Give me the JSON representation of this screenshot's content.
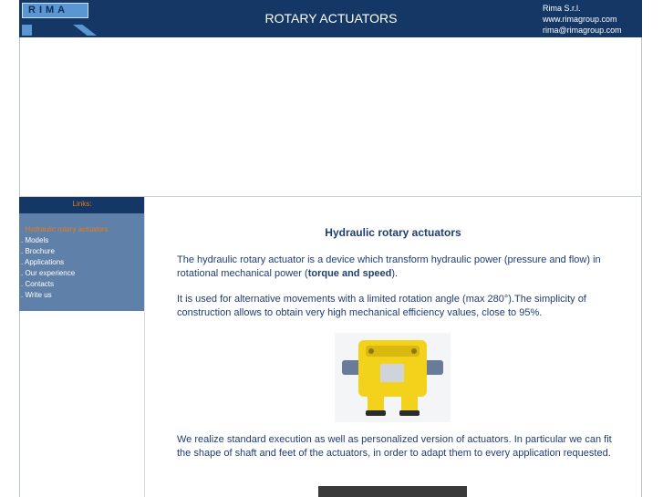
{
  "header": {
    "logo_text": "RIMA",
    "title": "ROTARY ACTUATORS",
    "company_name": "Rima S.r.l.",
    "website": "www.rimagroup.com",
    "email": "rima@rimagroup.com"
  },
  "sidebar": {
    "heading": "Links:",
    "items": [
      {
        "label": ". Hydraulic rotary actuators",
        "active": true
      },
      {
        "label": ". Models"
      },
      {
        "label": ". Brochure"
      },
      {
        "label": ". Applications"
      },
      {
        "label": ". Our experience"
      },
      {
        "label": ". Contacts"
      },
      {
        "label": ". Write us"
      }
    ]
  },
  "content": {
    "heading": "Hydraulic rotary actuators",
    "p1_before": "The hydraulic rotary actuator is a device which transform hydraulic power (pressure and flow) in rotational mechanical power (",
    "p1_bold": "torque and speed",
    "p1_after": ").",
    "p2": "It is used for alternative movements with a limited rotation angle (max 280°).The simplicity of construction allows to obtain very high mechanical efficiency values, close to 95%.",
    "p3": "We realize standard execution as well as personalized version of actuators. In particular we can fit the shape of shaft and feet of the actuators, in order to adapt them to every application requested."
  },
  "colors": {
    "header_bg": "#153765",
    "sidebar_bg": "#5f80a8",
    "accent": "#e87c1e",
    "text": "#1f3d73",
    "actuator_yellow": "#f2d21a"
  }
}
